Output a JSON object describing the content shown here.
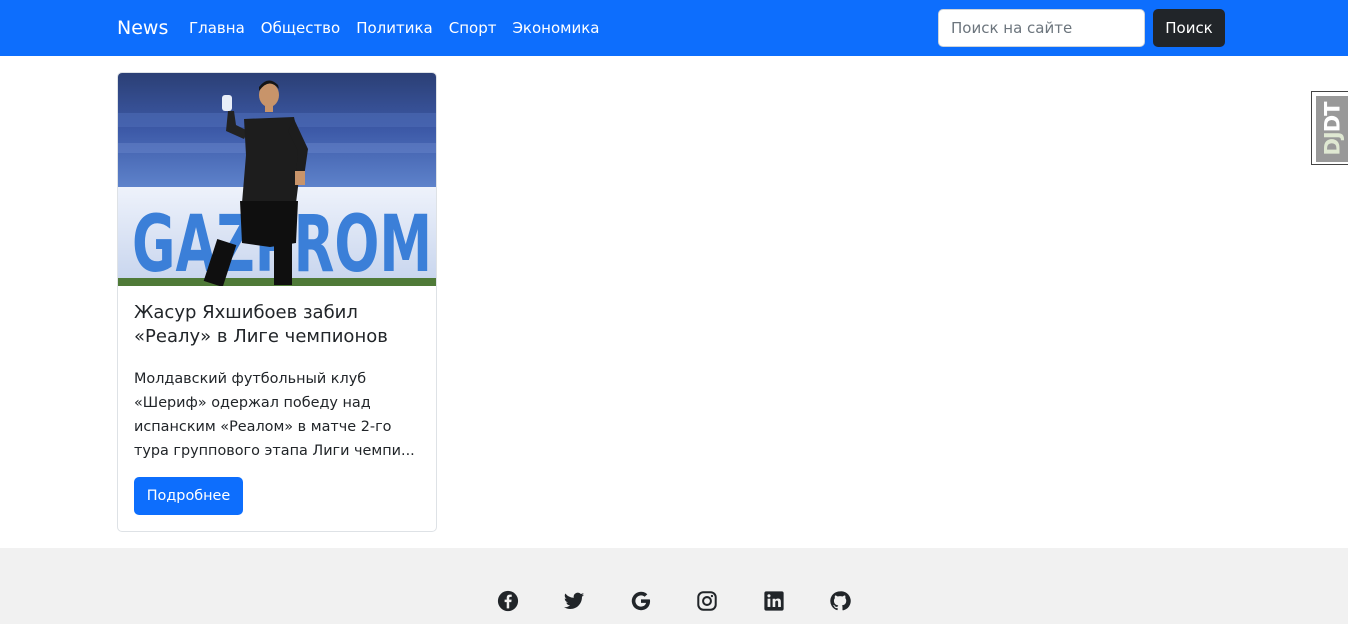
{
  "navbar": {
    "brand": "News",
    "links": [
      "Главна",
      "Общество",
      "Политика",
      "Спорт",
      "Экономика"
    ],
    "search_placeholder": "Поиск на сайте",
    "search_button": "Поиск",
    "color": "#0d6efd"
  },
  "card": {
    "title": "Жасур Яхшибоев забил «Реалу» в Лиге чемпионов",
    "text": "Молдавский футбольный клуб «Шериф» одержал победу над испанским «Реалом» в матче 2-го тура группового этапа Лиги чемпи...",
    "button": "Подробнее",
    "image_banner_text": "GAZPROM"
  },
  "debug_toolbar": {
    "prefix": "DJ",
    "suffix": "DT"
  },
  "footer": {
    "social_icons": [
      "facebook-icon",
      "twitter-icon",
      "google-icon",
      "instagram-icon",
      "linkedin-icon",
      "github-icon"
    ]
  }
}
